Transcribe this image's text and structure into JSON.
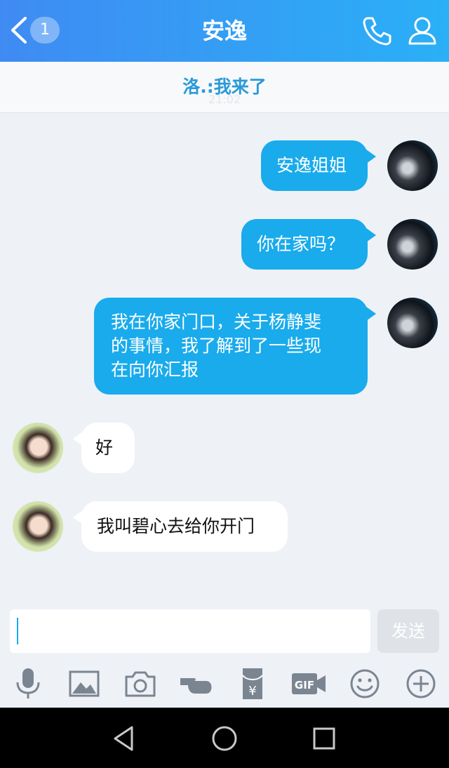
{
  "header": {
    "title": "安逸",
    "unread_count": "1",
    "icons": {
      "back": "chevron-left-icon",
      "call": "phone-icon",
      "profile": "user-icon"
    }
  },
  "notice": {
    "text": "洛.:我来了",
    "time": "21:02"
  },
  "messages": [
    {
      "side": "outgoing",
      "text": "安逸姐姐"
    },
    {
      "side": "outgoing",
      "text": "你在家吗？"
    },
    {
      "side": "outgoing",
      "lines": [
        "我在你家门口，关于杨静斐",
        "的事情，我了解到了一些现",
        "在向你汇报"
      ]
    },
    {
      "side": "incoming",
      "text": "好"
    },
    {
      "side": "incoming",
      "text": "我叫碧心去给你开门"
    }
  ],
  "composer": {
    "value": "",
    "send_label": "发送"
  },
  "toolbar": [
    "microphone-icon",
    "image-icon",
    "camera-icon",
    "poke-hand-icon",
    "red-packet-icon",
    "gif-icon",
    "emoji-icon",
    "plus-icon"
  ],
  "colors": {
    "header_start": "#3f8bf3",
    "header_end": "#2ab0f6",
    "bubble_out": "#19abec",
    "accent_text": "#2a9ad8"
  }
}
